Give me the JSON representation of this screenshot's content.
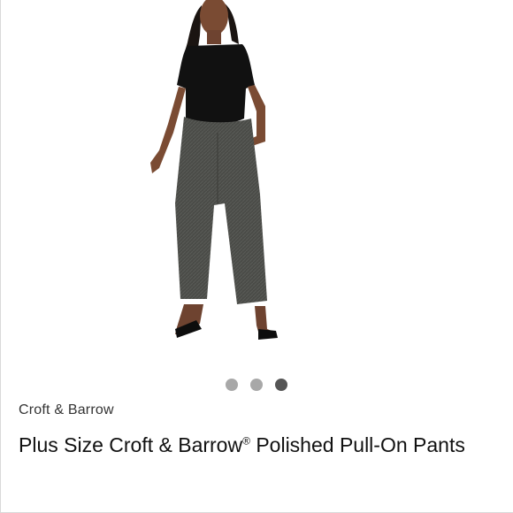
{
  "product": {
    "brand": "Croft & Barrow",
    "title_part1": "Plus Size Croft & Barrow",
    "registered_mark": "®",
    "title_part2": " Polished Pull-On Pants"
  },
  "carousel": {
    "total": 3,
    "active_index": 2
  },
  "colors": {
    "dot_inactive": "#a8a8a8",
    "dot_active": "#555555",
    "pants": "#4a4b47",
    "top": "#111111",
    "skin": "#7a4b33"
  }
}
